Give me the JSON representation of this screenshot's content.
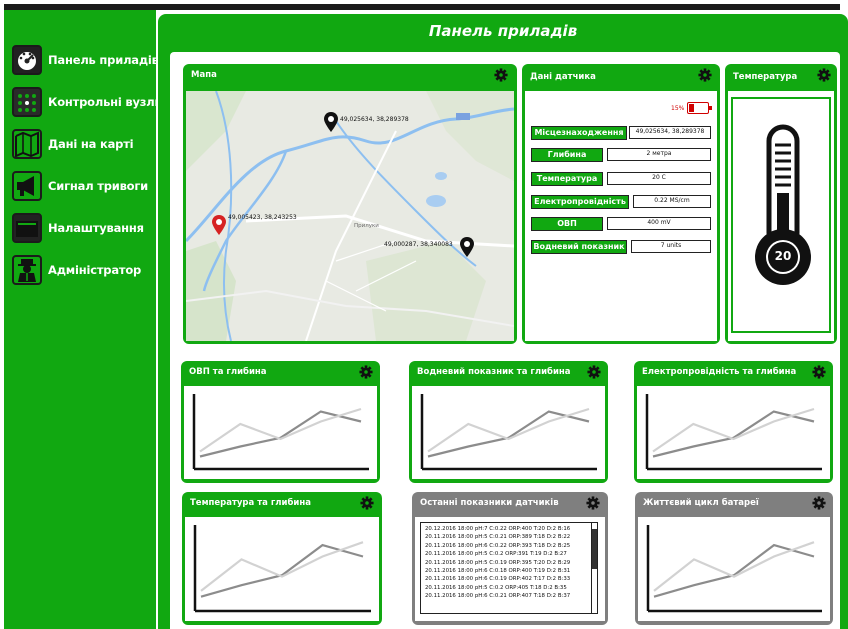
{
  "sidebar": {
    "items": [
      {
        "label": "Панель приладів",
        "icon": "dashboard-gauge-icon"
      },
      {
        "label": "Контрольні вузли",
        "icon": "nodes-grid-icon"
      },
      {
        "label": "Дані на карті",
        "icon": "map-icon"
      },
      {
        "label": "Сигнал тривоги",
        "icon": "megaphone-icon"
      },
      {
        "label": "Налаштування",
        "icon": "settings-box-icon"
      },
      {
        "label": "Адміністратор",
        "icon": "admin-agent-icon"
      }
    ]
  },
  "header": {
    "title": "Панель приладів"
  },
  "map_panel": {
    "title": "Мапа",
    "place_label": "Прилуки",
    "markers": [
      {
        "coords": "49,025634, 38,289378",
        "color": "#111111"
      },
      {
        "coords": "49,005423, 38,243253",
        "color": "#d62222"
      },
      {
        "coords": "49,000287, 38,340083",
        "color": "#111111"
      }
    ]
  },
  "sensor_panel": {
    "title": "Дані датчика",
    "battery_text": "15%",
    "rows": [
      {
        "label": "Місцезнаходження",
        "value": "49,025634, 38,289378"
      },
      {
        "label": "Глибина",
        "value": "2 метра"
      },
      {
        "label": "Температура",
        "value": "20 С"
      },
      {
        "label": "Електропровідність",
        "value": "0.22 MS/cm"
      },
      {
        "label": "ОВП",
        "value": "400 mV"
      },
      {
        "label": "Водневий показник",
        "value": "7 units"
      }
    ]
  },
  "temperature_panel": {
    "title": "Температура",
    "value": "20"
  },
  "charts": [
    {
      "title": "ОВП та глибина"
    },
    {
      "title": "Водневий показник та глибина"
    },
    {
      "title": "Електропровідність та глибина"
    },
    {
      "title": "Температура та глибина"
    },
    {
      "title": "Життєвий цикл батареї"
    }
  ],
  "chart_data": [
    {
      "type": "line",
      "series": [
        {
          "values": [
            1,
            1.8,
            2.5,
            4.6,
            3.8
          ]
        },
        {
          "values": [
            1.4,
            3.6,
            2.4,
            3.8,
            4.8
          ]
        }
      ],
      "ylim": [
        0,
        6
      ]
    },
    {
      "type": "line",
      "series": [
        {
          "values": [
            1,
            1.8,
            2.5,
            4.6,
            3.8
          ]
        },
        {
          "values": [
            1.4,
            3.6,
            2.4,
            3.8,
            4.8
          ]
        }
      ],
      "ylim": [
        0,
        6
      ]
    },
    {
      "type": "line",
      "series": [
        {
          "values": [
            1,
            1.8,
            2.5,
            4.6,
            3.8
          ]
        },
        {
          "values": [
            1.4,
            3.6,
            2.4,
            3.8,
            4.8
          ]
        }
      ],
      "ylim": [
        0,
        6
      ]
    },
    {
      "type": "line",
      "series": [
        {
          "values": [
            1,
            1.8,
            2.5,
            4.6,
            3.8
          ]
        },
        {
          "values": [
            1.4,
            3.6,
            2.4,
            3.8,
            4.8
          ]
        }
      ],
      "ylim": [
        0,
        6
      ]
    },
    {
      "type": "line",
      "series": [
        {
          "values": [
            1,
            1.8,
            2.5,
            4.6,
            3.8
          ]
        },
        {
          "values": [
            1.4,
            3.6,
            2.4,
            3.8,
            4.8
          ]
        }
      ],
      "ylim": [
        0,
        6
      ]
    }
  ],
  "readings_panel": {
    "title": "Останні показники датчиків",
    "lines": [
      "20.12.2016 18:00 pH:7 C:0.22 ORP:400 T:20 D:2 B:16",
      "20.11.2016 18:00 pH:5 C:0.21 ORP:389 T:18 D:2 B:22",
      "20.11.2016 18:00 pH:6 C:0.22 ORP:393 T:18 D:2 B:25",
      "20.11.2016 18:00 pH:5 C:0.2 ORP:391 T:19 D:2 B:27",
      "20.11.2016 18:00 pH:5 C:0.19 ORP:395 T:20 D:2 B:29",
      "20.11.2016 18:00 pH:6 C:0.18 ORP:400 T:19 D:2 B:31",
      "20.11.2016 18:00 pH:6 C:0.19 ORP:402 T:17 D:2 B:33",
      "20.11.2016 18:00 pH:5 C:0.2 ORP:405 T:18 D:2 B:35",
      "20.11.2016 18:00 pH:6 C:0.21 ORP:407 T:18 D:2 B:37"
    ]
  },
  "colors": {
    "accent": "#11a811",
    "panel_gray": "#7f7f7f",
    "alert": "#d00000",
    "text_dark": "#111111"
  }
}
